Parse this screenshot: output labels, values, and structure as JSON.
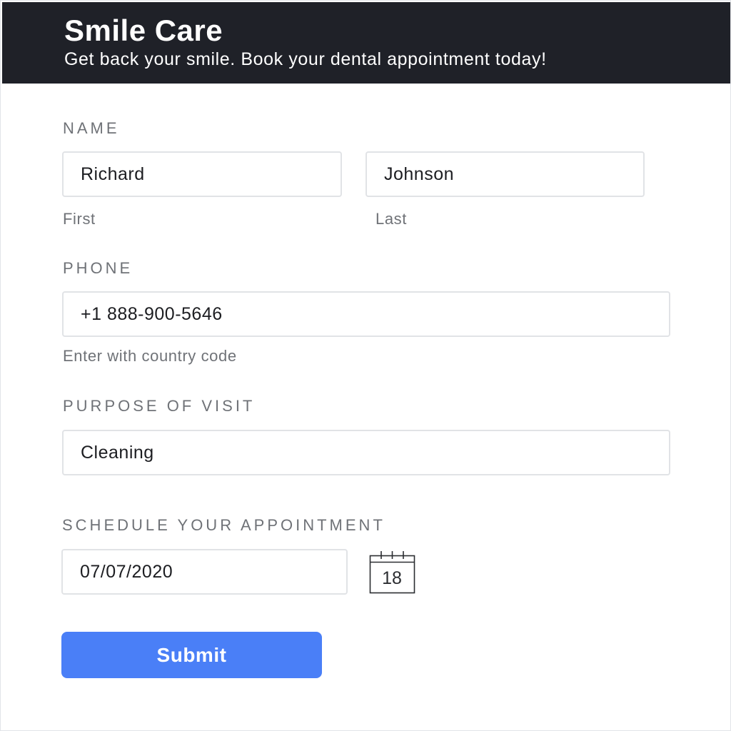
{
  "header": {
    "title": "Smile Care",
    "subtitle": "Get back your smile. Book your dental appointment today!"
  },
  "form": {
    "name": {
      "label": "NAME",
      "first_value": "Richard",
      "first_helper": "First",
      "last_value": "Johnson",
      "last_helper": "Last"
    },
    "phone": {
      "label": "PHONE",
      "value": "+1 888-900-5646",
      "helper": "Enter with country code"
    },
    "purpose": {
      "label": "PURPOSE OF VISIT",
      "value": "Cleaning"
    },
    "schedule": {
      "label": "SCHEDULE YOUR APPOINTMENT",
      "value": "07/07/2020",
      "calendar_icon_day": "18",
      "calendar_icon": "calendar-icon"
    },
    "submit_label": "Submit"
  },
  "colors": {
    "header_bg": "#1f2128",
    "accent": "#4a7ff7"
  }
}
